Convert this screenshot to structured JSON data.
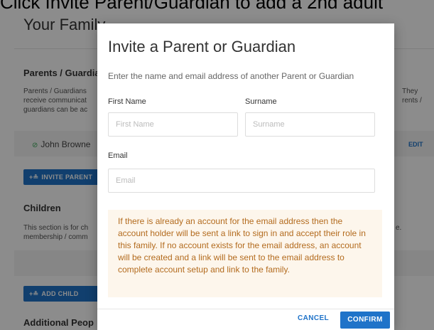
{
  "caption": "Click Invite Parent/Guardian to add a 2nd adult",
  "background": {
    "page_title": "Your Family",
    "parents_section": {
      "heading": "Parents / Guardians",
      "description_line1": "Parents / Guardians",
      "description_line2": "receive communicat",
      "description_line3": "guardians can be ac",
      "right_text_line1": "They",
      "right_text_line2": "rents /",
      "person_name": "John Browne",
      "edit_label": "EDIT",
      "invite_button_label": "INVITE PARENT"
    },
    "children_section": {
      "heading": "Children",
      "description_line1": "This section is for ch",
      "description_line2": "membership / comm",
      "right_text": "e.",
      "add_child_button_label": "ADD CHILD"
    },
    "additional_section": {
      "heading": "Additional Peop"
    }
  },
  "modal": {
    "title": "Invite a Parent or Guardian",
    "subtitle": "Enter the name and email address of another Parent or Guardian",
    "first_name": {
      "label": "First Name",
      "placeholder": "First Name",
      "value": ""
    },
    "surname": {
      "label": "Surname",
      "placeholder": "Surname",
      "value": ""
    },
    "email": {
      "label": "Email",
      "placeholder": "Email",
      "value": ""
    },
    "notice": "If there is already an account for the email address then the account holder will be sent a link to sign in and accept their role in this family. If no account exists for the email address, an account will be created and a link will be sent to the email address to complete account setup and link to the family.",
    "cancel_label": "CANCEL",
    "confirm_label": "CONFIRM"
  },
  "colors": {
    "accent": "#1f73c9",
    "notice_bg": "#fdf6ec",
    "notice_text": "#b36b1e",
    "ok_icon": "#3aa757"
  },
  "icons": {
    "add_person": "add-person-icon",
    "check": "check-circle-icon"
  }
}
